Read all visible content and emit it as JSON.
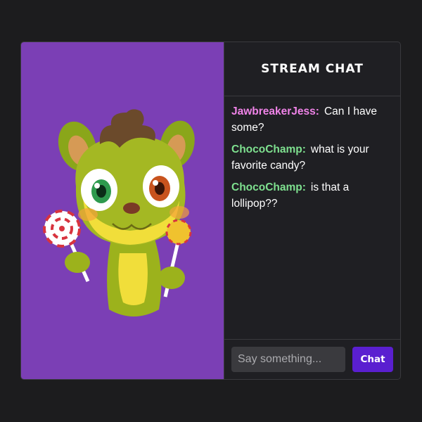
{
  "chat": {
    "title": "STREAM CHAT",
    "messages": [
      {
        "user": "JawbreakerJess:",
        "text": "Can I have some?",
        "color": "#f083e8"
      },
      {
        "user": "ChocoChamp:",
        "text": "what is your favorite candy?",
        "color": "#7ee08f"
      },
      {
        "user": "ChocoChamp:",
        "text": "is that a lollipop??",
        "color": "#7ee08f"
      }
    ],
    "input_placeholder": "Say something...",
    "send_label": "Chat"
  },
  "colors": {
    "stage_background": "#7b3fb5",
    "accent": "#5a1fd0"
  },
  "stage": {
    "character": "cartoon-squirrel-with-lollipops"
  }
}
